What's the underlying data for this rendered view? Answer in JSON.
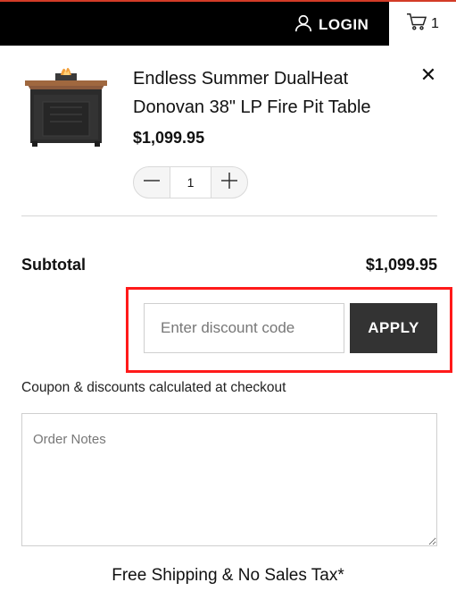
{
  "header": {
    "login_label": "LOGIN",
    "login_icon": "user-icon",
    "cart_icon": "shopping-cart-icon",
    "cart_count": "1"
  },
  "product": {
    "title": "Endless Summer DualHeat Donovan 38\" LP Fire Pit Table",
    "price": "$1,099.95",
    "quantity": "1",
    "remove_icon": "close-icon"
  },
  "summary": {
    "subtotal_label": "Subtotal",
    "subtotal_value": "$1,099.95"
  },
  "discount": {
    "placeholder": "Enter discount code",
    "apply_label": "APPLY",
    "note": "Coupon & discounts calculated at checkout"
  },
  "order_notes": {
    "placeholder": "Order Notes"
  },
  "footer": {
    "shipping_text": "Free Shipping & No Sales Tax*"
  },
  "colors": {
    "header_bg": "#000000",
    "accent_line": "#d33c27",
    "apply_bg": "#333333",
    "highlight": "#ff1a1a"
  }
}
